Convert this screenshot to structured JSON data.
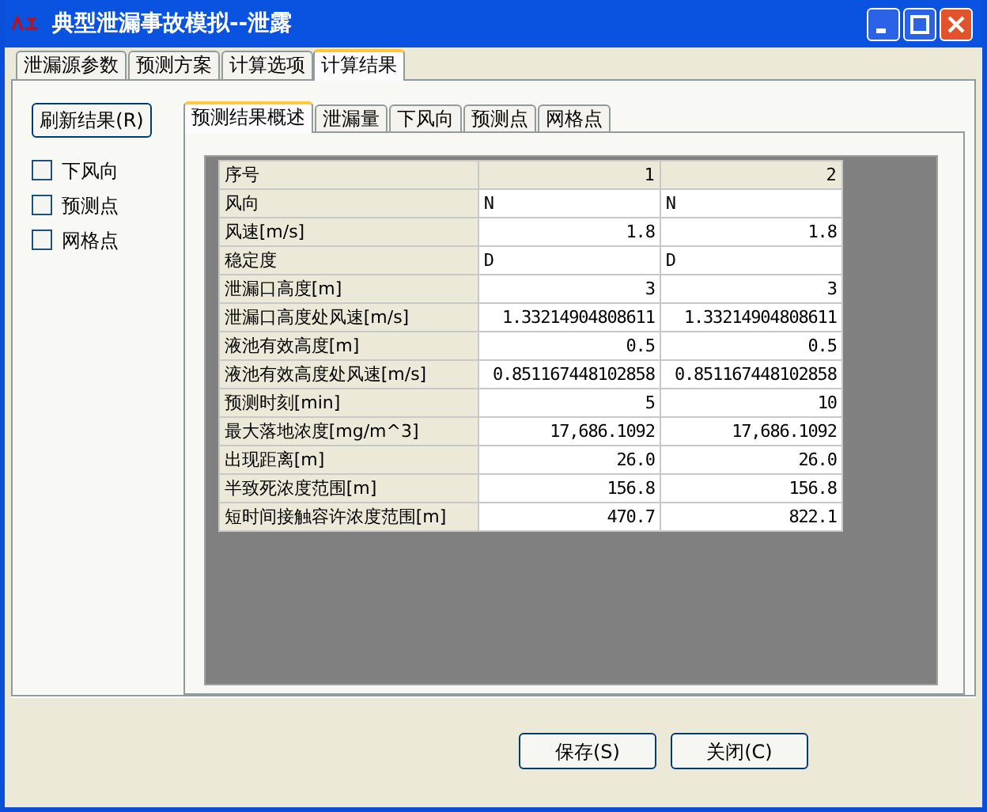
{
  "window": {
    "title": "典型泄漏事故模拟--泄露"
  },
  "tabs": [
    {
      "label": "泄漏源参数",
      "selected": false
    },
    {
      "label": "预测方案",
      "selected": false
    },
    {
      "label": "计算选项",
      "selected": false
    },
    {
      "label": "计算结果",
      "selected": true
    }
  ],
  "refresh_button": "刷新结果(R)",
  "checkboxes": [
    {
      "label": "下风向",
      "checked": false
    },
    {
      "label": "预测点",
      "checked": false
    },
    {
      "label": "网格点",
      "checked": false
    }
  ],
  "result_tabs": [
    {
      "label": "预测结果概述",
      "selected": true
    },
    {
      "label": "泄漏量",
      "selected": false
    },
    {
      "label": "下风向",
      "selected": false
    },
    {
      "label": "预测点",
      "selected": false
    },
    {
      "label": "网格点",
      "selected": false
    }
  ],
  "grid": {
    "header": {
      "label": "序号",
      "values": [
        "1",
        "2"
      ]
    },
    "rows": [
      {
        "label": "风向",
        "kind": "text",
        "values": [
          "N",
          "N"
        ]
      },
      {
        "label": "风速[m/s]",
        "kind": "number",
        "values": [
          "1.8",
          "1.8"
        ]
      },
      {
        "label": "稳定度",
        "kind": "text",
        "values": [
          "D",
          "D"
        ]
      },
      {
        "label": "泄漏口高度[m]",
        "kind": "number",
        "values": [
          "3",
          "3"
        ]
      },
      {
        "label": "泄漏口高度处风速[m/s]",
        "kind": "number",
        "values": [
          "1.33214904808611",
          "1.33214904808611"
        ]
      },
      {
        "label": "液池有效高度[m]",
        "kind": "number",
        "values": [
          "0.5",
          "0.5"
        ]
      },
      {
        "label": "液池有效高度处风速[m/s]",
        "kind": "number",
        "values": [
          "0.851167448102858",
          "0.851167448102858"
        ]
      },
      {
        "label": "预测时刻[min]",
        "kind": "number",
        "values": [
          "5",
          "10"
        ]
      },
      {
        "label": "最大落地浓度[mg/m^3]",
        "kind": "number",
        "values": [
          "17,686.1092",
          "17,686.1092"
        ]
      },
      {
        "label": "出现距离[m]",
        "kind": "number",
        "values": [
          "26.0",
          "26.0"
        ]
      },
      {
        "label": "半致死浓度范围[m]",
        "kind": "number",
        "values": [
          "156.8",
          "156.8"
        ]
      },
      {
        "label": "短时间接触容许浓度范围[m]",
        "kind": "number",
        "values": [
          "470.7",
          "822.1"
        ]
      }
    ]
  },
  "buttons": [
    "保存(S)",
    "关闭(C)"
  ]
}
